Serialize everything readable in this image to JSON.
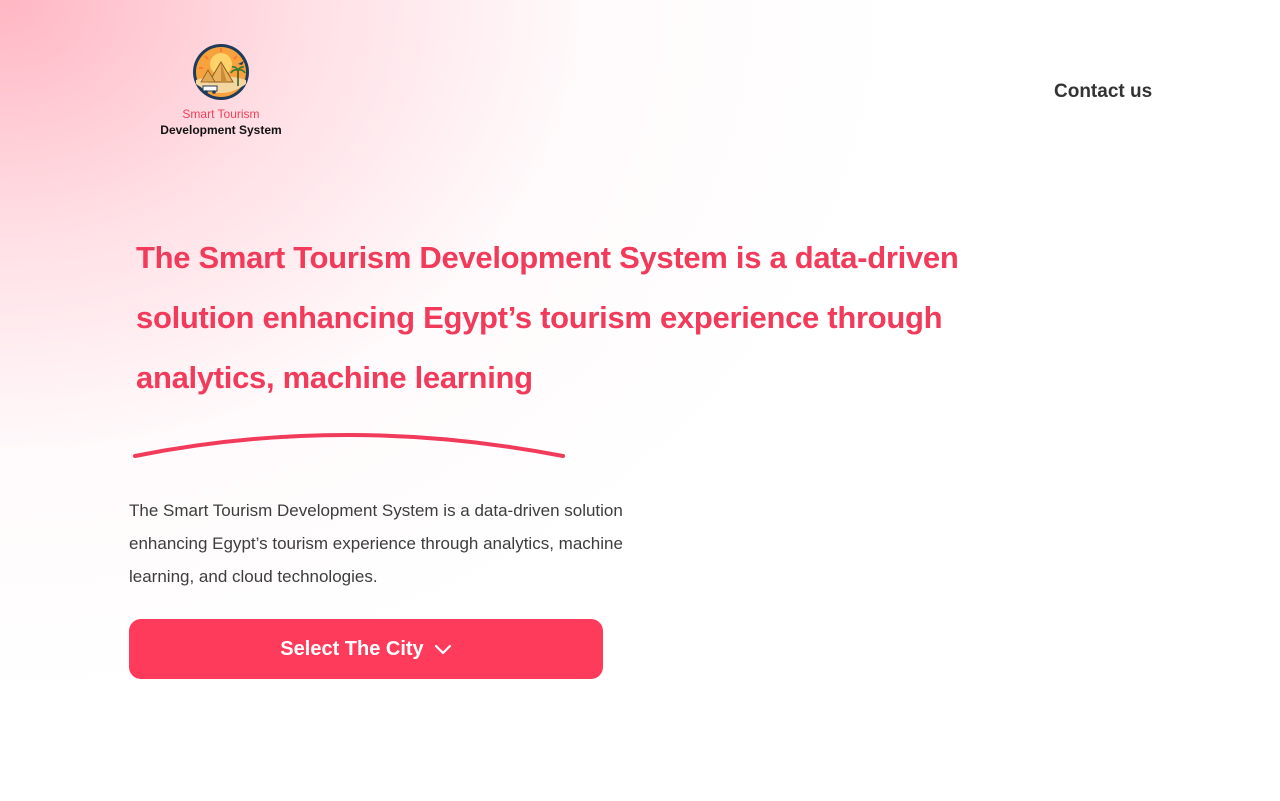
{
  "header": {
    "logo": {
      "line1": "Smart Tourism",
      "line2": "Development System",
      "emblem_icon": "pyramid-sun-emblem-icon"
    },
    "contact_label": "Contact us"
  },
  "hero": {
    "title": "The Smart Tourism Development System is a data-driven solution enhancing Egypt’s tourism experience through analytics, machine learning",
    "description": "The Smart Tourism Development System is a data-driven solution enhancing Egypt’s tourism experience through analytics, machine learning, and cloud technologies.",
    "cta_label": "Select The City",
    "cta_icon": "chevron-down-icon"
  },
  "colors": {
    "accent": "#ff3b5c",
    "title": "#f23a5a",
    "text": "#3d3d3d",
    "heading_dark": "#333333"
  }
}
